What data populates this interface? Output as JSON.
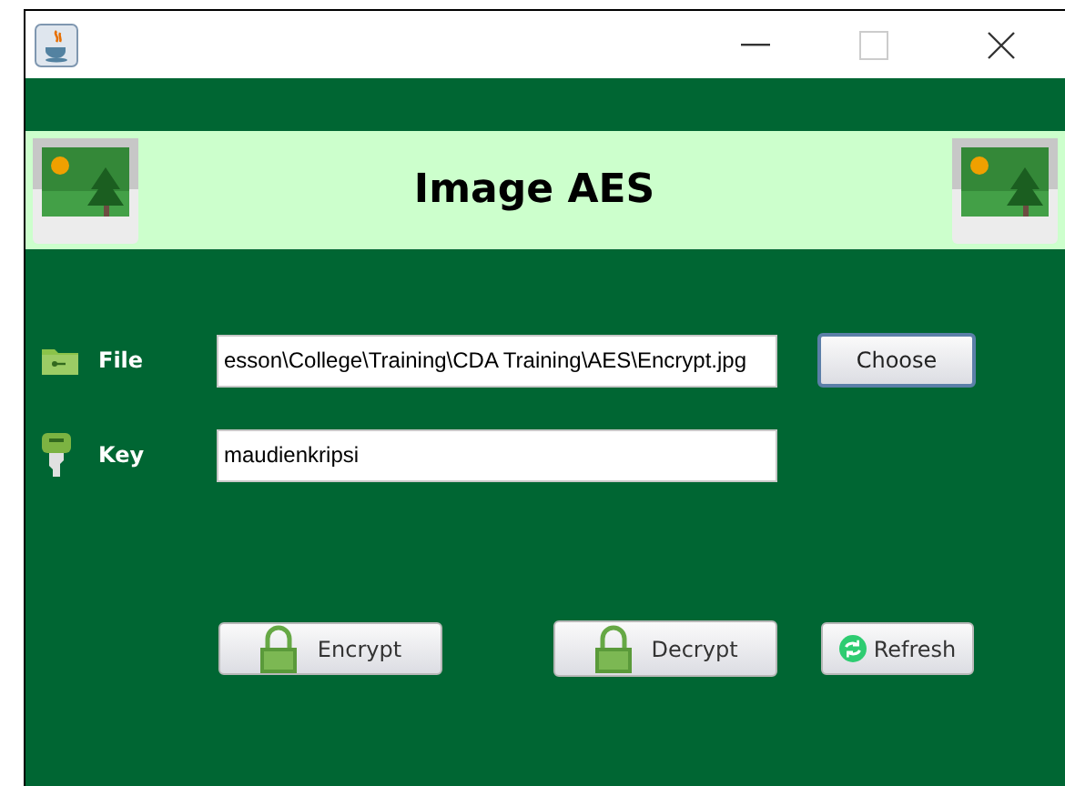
{
  "banner": {
    "title": "Image AES"
  },
  "fields": [
    {
      "kind": "file",
      "label": "File",
      "value": "esson\\College\\Training\\CDA Training\\AES\\Encrypt.jpg",
      "button": "Choose"
    },
    {
      "kind": "key",
      "label": "Key",
      "value": "maudienkripsi"
    }
  ],
  "buttons": [
    {
      "kind": "lock",
      "label": "Encrypt"
    },
    {
      "kind": "lock",
      "label": "Decrypt"
    },
    {
      "kind": "refresh",
      "label": "Refresh"
    }
  ]
}
